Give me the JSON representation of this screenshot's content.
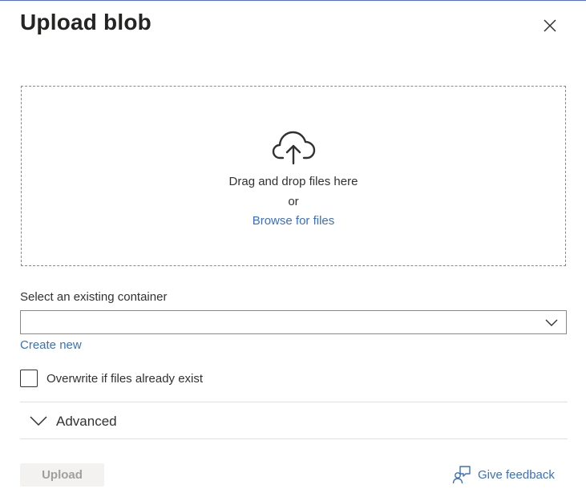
{
  "panel": {
    "title": "Upload blob",
    "close_icon": "close-icon"
  },
  "dropzone": {
    "icon": "cloud-upload-icon",
    "drag_text": "Drag and drop files here",
    "or_text": "or",
    "browse_label": "Browse for files"
  },
  "container": {
    "label": "Select an existing container",
    "selected_value": "",
    "chevron_icon": "chevron-down-icon",
    "create_new_label": "Create new"
  },
  "overwrite": {
    "label": "Overwrite if files already exist",
    "checked": false
  },
  "advanced": {
    "label": "Advanced",
    "expanded": false,
    "chevron_icon": "chevron-down-icon"
  },
  "footer": {
    "upload_label": "Upload",
    "upload_disabled": true,
    "feedback_label": "Give feedback",
    "feedback_icon": "feedback-person-icon"
  },
  "colors": {
    "accent_line": "#4f6bed",
    "link": "#3a6fc4",
    "disabled_button_bg": "#f3f2f1",
    "disabled_button_text": "#a19f9d"
  }
}
